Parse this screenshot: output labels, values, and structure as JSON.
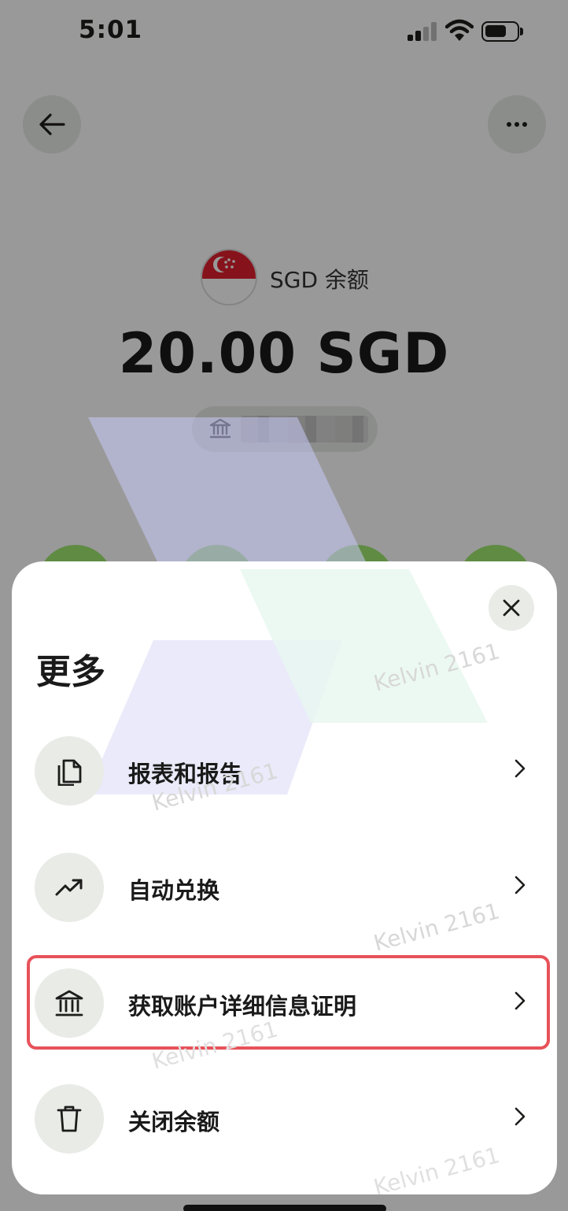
{
  "status_bar": {
    "time": "5:01"
  },
  "header": {
    "back_icon": "arrow-left-icon",
    "more_icon": "more-horizontal-icon"
  },
  "balance_card": {
    "currency_label": "SGD 余额",
    "amount": "20.00 SGD",
    "flag_icon": "singapore-flag-icon",
    "bank_icon": "bank-icon"
  },
  "sheet": {
    "title": "更多",
    "close_icon": "close-icon",
    "items": [
      {
        "label": "报表和报告",
        "icon": "document-icon"
      },
      {
        "label": "自动兑换",
        "icon": "trending-up-icon"
      },
      {
        "label": "获取账户详细信息证明",
        "icon": "bank-icon",
        "highlighted": true
      },
      {
        "label": "关闭余额",
        "icon": "trash-icon"
      }
    ]
  },
  "watermark": {
    "text": "Kelvin 2161"
  },
  "colors": {
    "accent_green": "#9fe870",
    "highlight_red": "#e8525a",
    "icon_bg": "#e8ebe6"
  }
}
